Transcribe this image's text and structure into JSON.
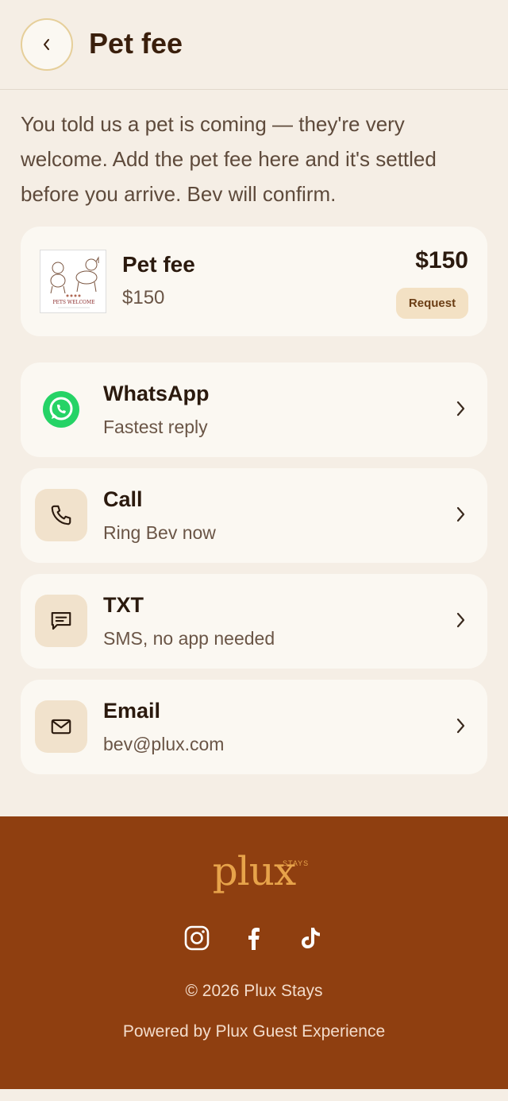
{
  "header": {
    "title": "Pet fee"
  },
  "intro": "You told us a pet is coming — they're very welcome. Add the pet fee here and it's settled before you arrive. Bev will confirm.",
  "fee": {
    "name": "Pet fee",
    "subtitle": "$150",
    "price": "$150",
    "request_label": "Request",
    "image_text": "PETS WELCOME"
  },
  "contacts": [
    {
      "title": "WhatsApp",
      "subtitle": "Fastest reply",
      "icon": "whatsapp-icon"
    },
    {
      "title": "Call",
      "subtitle": "Ring Bev now",
      "icon": "phone-icon"
    },
    {
      "title": "TXT",
      "subtitle": "SMS, no app needed",
      "icon": "message-icon"
    },
    {
      "title": "Email",
      "subtitle": "bev@plux.com",
      "icon": "mail-icon"
    }
  ],
  "footer": {
    "logo": "plux",
    "logo_sub": "STAYS",
    "copyright": "© 2026 Plux Stays",
    "powered": "Powered by Plux Guest Experience",
    "socials": [
      "instagram-icon",
      "facebook-icon",
      "tiktok-icon"
    ]
  },
  "colors": {
    "background": "#f5eee5",
    "card": "#fbf8f2",
    "footer": "#8f3f10",
    "accent": "#e7a34a",
    "whatsapp": "#25d366"
  }
}
